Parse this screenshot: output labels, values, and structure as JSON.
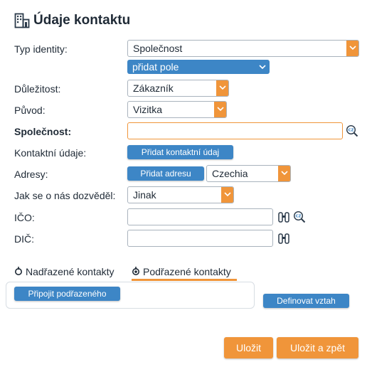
{
  "header": {
    "title": "Údaje kontaktu",
    "icon": "contact-building-icon"
  },
  "form": {
    "identity_type": {
      "label": "Typ identity:",
      "value": "Společnost"
    },
    "add_field": {
      "label": "přidat pole"
    },
    "importance": {
      "label": "Důležitost:",
      "value": "Zákazník"
    },
    "origin": {
      "label": "Původ:",
      "value": "Vizitka"
    },
    "company": {
      "label": "Společnost:",
      "value": ""
    },
    "contact_details": {
      "label": "Kontaktní údaje:",
      "button": "Přidat kontaktní údaj"
    },
    "addresses": {
      "label": "Adresy:",
      "button": "Přidat adresu",
      "country": "Czechia"
    },
    "referral": {
      "label": "Jak se o nás dozvěděl:",
      "value": "Jinak"
    },
    "ico": {
      "label": "IČO:",
      "value": ""
    },
    "dic": {
      "label": "DIČ:",
      "value": ""
    }
  },
  "tabs": {
    "parent": "Nadřazené kontakty",
    "child": "Podřazené kontakty",
    "active": "child"
  },
  "panel": {
    "attach_button": "Připojit podřazeného",
    "define_button": "Definovat vztah"
  },
  "footer": {
    "save": "Uložit",
    "save_back": "Uložit a zpět"
  },
  "colors": {
    "accent": "#f0953a",
    "primary": "#3d86c6",
    "text": "#1f2a36",
    "border": "#a9b3bd"
  }
}
